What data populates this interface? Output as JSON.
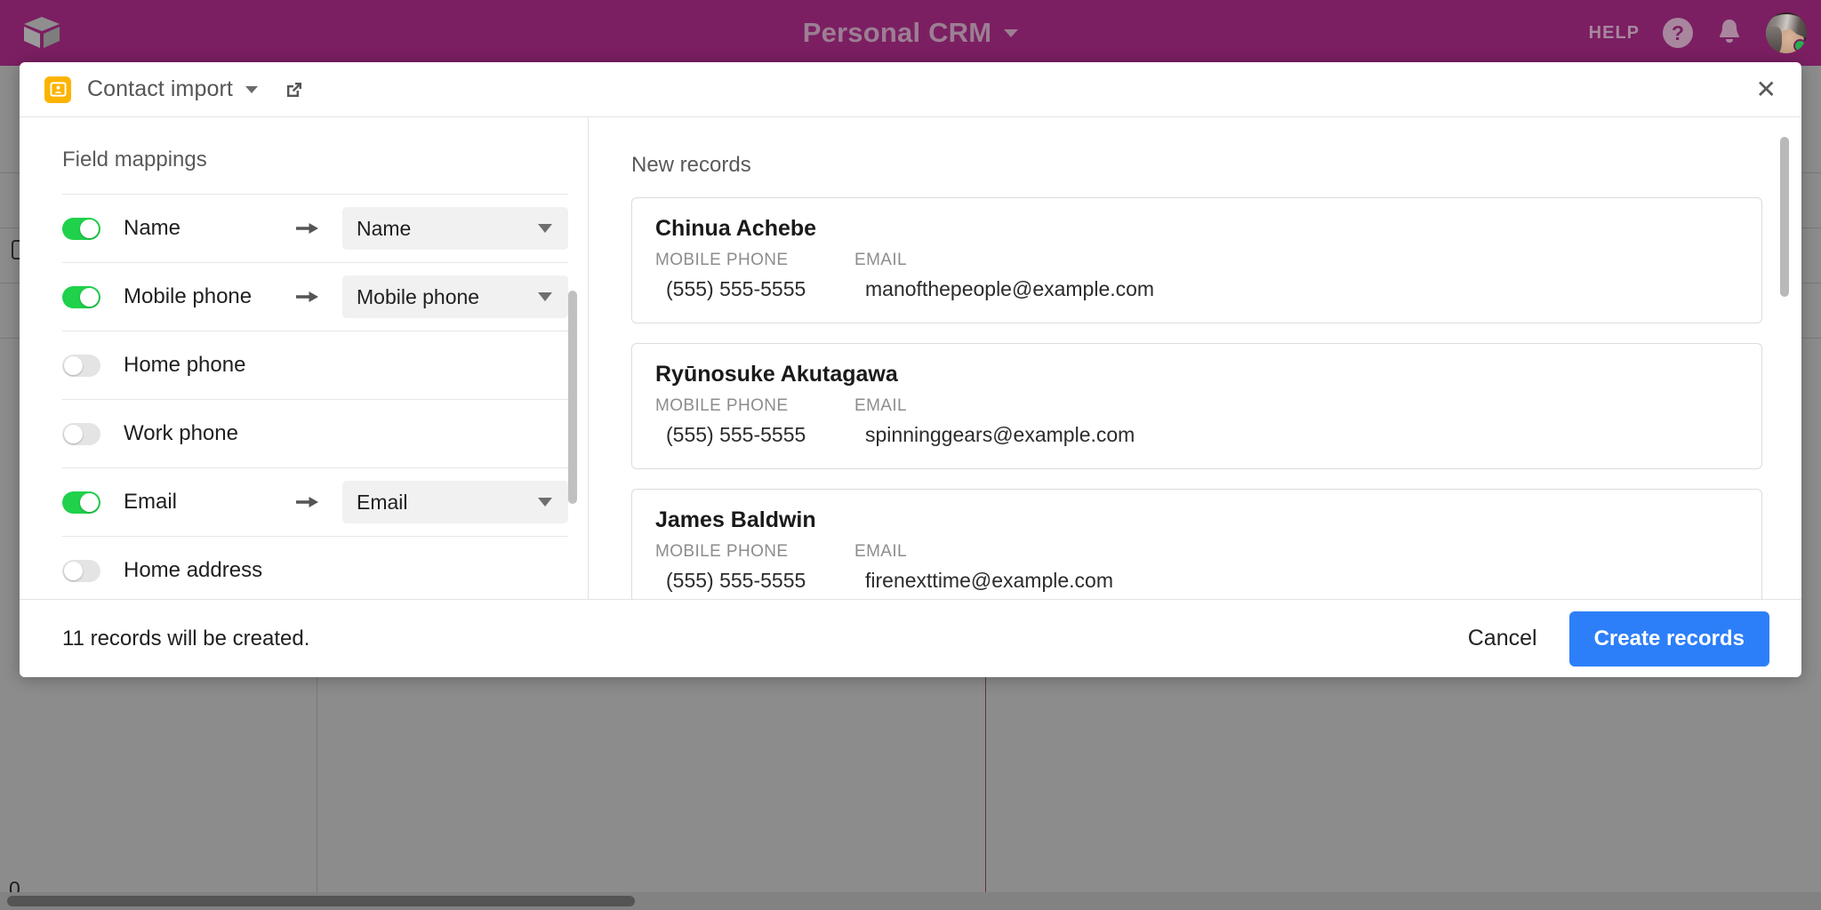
{
  "topbar": {
    "logo_icon": "airtable-cube-logo",
    "title": "Personal CRM",
    "title_caret_icon": "chevron-down-icon",
    "help_label": "HELP",
    "help_icon": "question-circle-icon",
    "notifications_icon": "bell-icon",
    "avatar_icon": "user-avatar",
    "status": "online",
    "bg_color": "#7b1f62",
    "text_color": "#9c7e93"
  },
  "background_grid": {
    "zero_label": "0",
    "checkbox_icon": "row-checkbox"
  },
  "modal": {
    "app_icon": "contact-card-icon",
    "title": "Contact import",
    "title_caret_icon": "chevron-down-icon",
    "expand_icon": "external-link-icon",
    "close_icon": "close-icon",
    "left": {
      "heading": "Field mappings",
      "mappings": [
        {
          "enabled": true,
          "source": "Name",
          "target": "Name"
        },
        {
          "enabled": true,
          "source": "Mobile phone",
          "target": "Mobile phone"
        },
        {
          "enabled": false,
          "source": "Home phone",
          "target": ""
        },
        {
          "enabled": false,
          "source": "Work phone",
          "target": ""
        },
        {
          "enabled": true,
          "source": "Email",
          "target": "Email"
        },
        {
          "enabled": false,
          "source": "Home address",
          "target": ""
        }
      ],
      "arrow_icon": "arrow-right-icon",
      "select_caret_icon": "caret-down-icon"
    },
    "right": {
      "heading": "New records",
      "field_labels": {
        "phone": "MOBILE PHONE",
        "email": "EMAIL"
      },
      "records": [
        {
          "name": "Chinua Achebe",
          "phone": "(555) 555-5555",
          "email": "manofthepeople@example.com"
        },
        {
          "name": "Ryūnosuke Akutagawa",
          "phone": "(555) 555-5555",
          "email": "spinninggears@example.com"
        },
        {
          "name": "James Baldwin",
          "phone": "(555) 555-5555",
          "email": "firenexttime@example.com"
        }
      ]
    },
    "footer": {
      "records_summary": "11 records will be created.",
      "cancel_label": "Cancel",
      "create_label": "Create records",
      "create_color": "#2d7ff9"
    }
  },
  "toggle_colors": {
    "on": "#1fd14b",
    "off": "#e4e4e4"
  }
}
